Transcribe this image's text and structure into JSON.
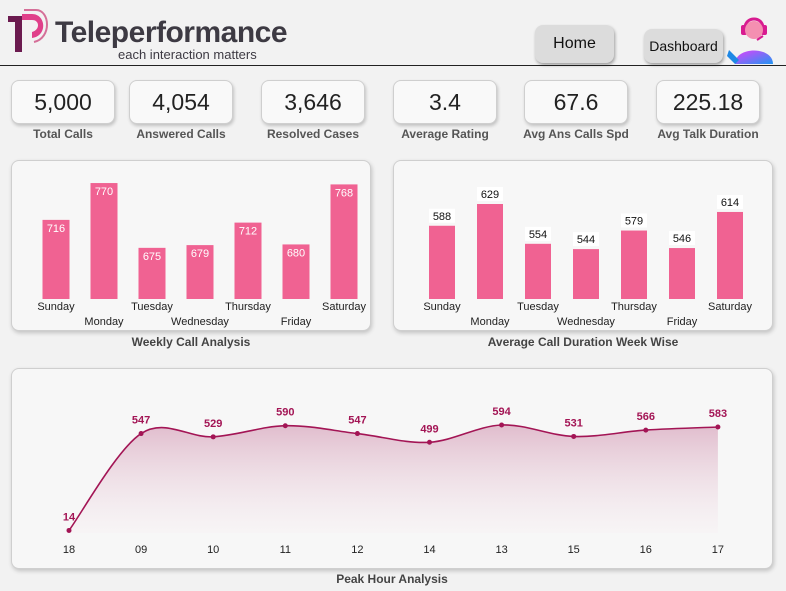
{
  "brand": {
    "name": "Teleperformance",
    "tagline": "each interaction matters",
    "colors": {
      "brand": "#8a1a55",
      "accent": "#f06292",
      "logo_pink": "#e0408a",
      "logo_dark": "#6b1b4f"
    }
  },
  "nav": {
    "home_label": "Home",
    "dashboard_label": "Dashboard",
    "agent_icon": "support-agent-icon"
  },
  "kpis": [
    {
      "value": "5,000",
      "label": "Total Calls"
    },
    {
      "value": "4,054",
      "label": "Answered Calls"
    },
    {
      "value": "3,646",
      "label": "Resolved Cases"
    },
    {
      "value": "3.4",
      "label": "Average Rating"
    },
    {
      "value": "67.6",
      "label": "Avg Ans Calls Spd"
    },
    {
      "value": "225.18",
      "label": "Avg Talk Duration"
    }
  ],
  "chart_data": [
    {
      "type": "bar",
      "title": "Weekly Call Analysis",
      "categories": [
        "Sunday",
        "Monday",
        "Tuesday",
        "Wednesday",
        "Thursday",
        "Friday",
        "Saturday"
      ],
      "values": [
        716,
        770,
        675,
        679,
        712,
        680,
        768
      ],
      "label_position": "inside-top",
      "color": "#f06292",
      "grid": false
    },
    {
      "type": "bar",
      "title": "Average Call Duration Week Wise",
      "categories": [
        "Sunday",
        "Monday",
        "Tuesday",
        "Wednesday",
        "Thursday",
        "Friday",
        "Saturday"
      ],
      "values": [
        588,
        629,
        554,
        544,
        579,
        546,
        614
      ],
      "label_position": "above",
      "color": "#f06292",
      "grid": false
    },
    {
      "type": "area",
      "title": "Peak Hour Analysis",
      "categories": [
        "18",
        "09",
        "10",
        "11",
        "12",
        "14",
        "13",
        "15",
        "16",
        "17"
      ],
      "values": [
        14,
        547,
        529,
        590,
        547,
        499,
        594,
        531,
        566,
        583
      ],
      "color": "#a31555",
      "grid": false
    }
  ]
}
